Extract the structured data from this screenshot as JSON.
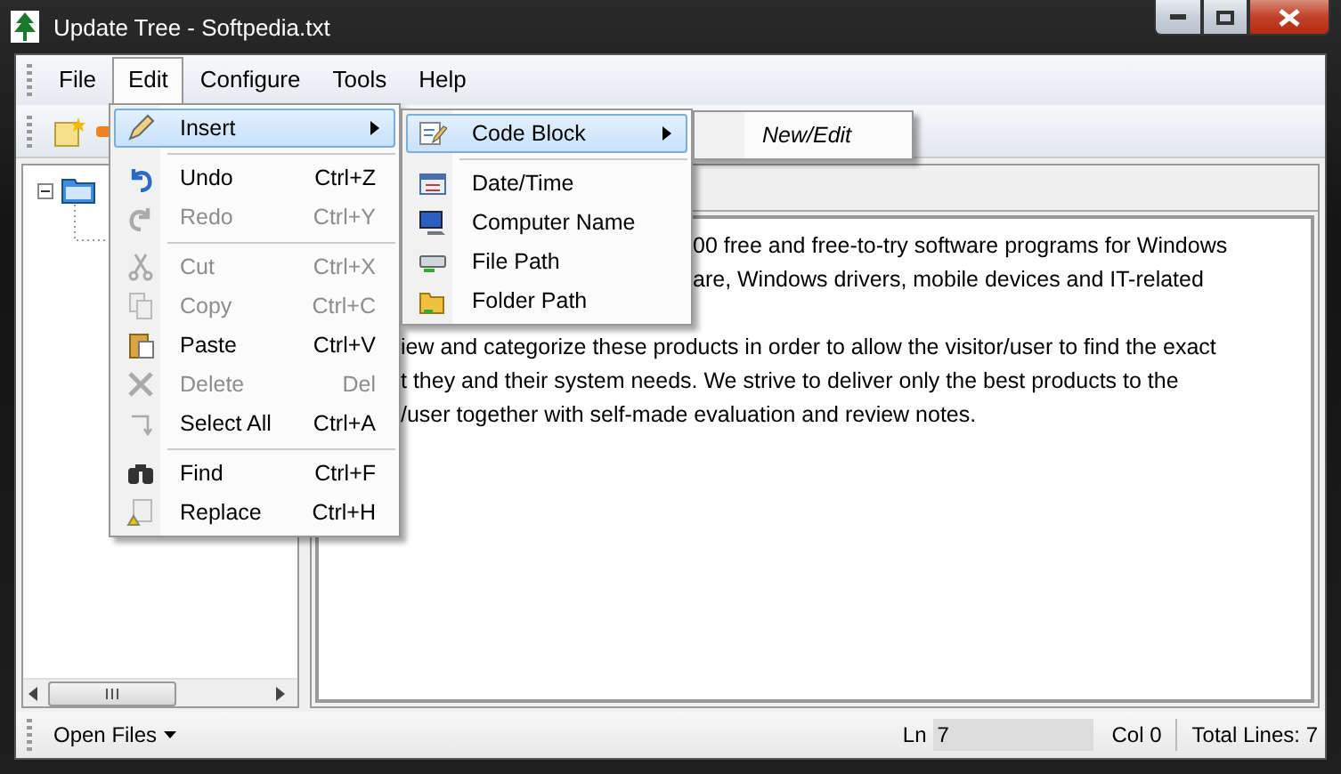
{
  "window": {
    "title": "Update Tree - Softpedia.txt"
  },
  "menu_bar": [
    {
      "label": "File",
      "selected": false
    },
    {
      "label": "Edit",
      "selected": true
    },
    {
      "label": "Configure",
      "selected": false
    },
    {
      "label": "Tools",
      "selected": false
    },
    {
      "label": "Help",
      "selected": false
    }
  ],
  "edit_menu": [
    {
      "kind": "item",
      "label": "Insert",
      "submenu": true,
      "disabled": false,
      "selected": true
    },
    {
      "kind": "separator"
    },
    {
      "kind": "item",
      "label": "Undo",
      "shortcut": "Ctrl+Z",
      "submenu": false,
      "disabled": false,
      "selected": false
    },
    {
      "kind": "item",
      "label": "Redo",
      "shortcut": "Ctrl+Y",
      "submenu": false,
      "disabled": true,
      "selected": false
    },
    {
      "kind": "separator"
    },
    {
      "kind": "item",
      "label": "Cut",
      "shortcut": "Ctrl+X",
      "submenu": false,
      "disabled": true,
      "selected": false
    },
    {
      "kind": "item",
      "label": "Copy",
      "shortcut": "Ctrl+C",
      "submenu": false,
      "disabled": true,
      "selected": false
    },
    {
      "kind": "item",
      "label": "Paste",
      "shortcut": "Ctrl+V",
      "submenu": false,
      "disabled": false,
      "selected": false
    },
    {
      "kind": "item",
      "label": "Delete",
      "shortcut": "Del",
      "submenu": false,
      "disabled": true,
      "selected": false
    },
    {
      "kind": "item",
      "label": "Select All",
      "shortcut": "Ctrl+A",
      "submenu": false,
      "disabled": false,
      "selected": false
    },
    {
      "kind": "separator"
    },
    {
      "kind": "item",
      "label": "Find",
      "shortcut": "Ctrl+F",
      "submenu": false,
      "disabled": false,
      "selected": false
    },
    {
      "kind": "item",
      "label": "Replace",
      "shortcut": "Ctrl+H",
      "submenu": false,
      "disabled": false,
      "selected": false
    }
  ],
  "insert_menu": [
    {
      "kind": "item",
      "label": "Code Block",
      "submenu": true,
      "selected": true
    },
    {
      "kind": "separator"
    },
    {
      "kind": "item",
      "label": "Date/Time",
      "submenu": false,
      "selected": false
    },
    {
      "kind": "item",
      "label": "Computer Name",
      "submenu": false,
      "selected": false
    },
    {
      "kind": "item",
      "label": "File Path",
      "submenu": false,
      "selected": false
    },
    {
      "kind": "item",
      "label": "Folder Path",
      "submenu": false,
      "selected": false
    }
  ],
  "code_block_menu": [
    {
      "label": "New/Edit"
    }
  ],
  "editor": {
    "paragraphs": [
      [
        "00 free and free-to-try software programs for Windows",
        "are, Windows drivers, mobile devices and IT-related"
      ],
      [
        "iew and categorize these products in order to allow the visitor/user to find the exact",
        "t they and their system needs. We strive to deliver only the best products to the",
        "/user together with self-made evaluation and review notes."
      ]
    ]
  },
  "status_bar": {
    "open_files": "Open Files",
    "line_label": "Ln",
    "line_value": "7",
    "column": "Col 0",
    "total_lines": "Total Lines: 7"
  }
}
